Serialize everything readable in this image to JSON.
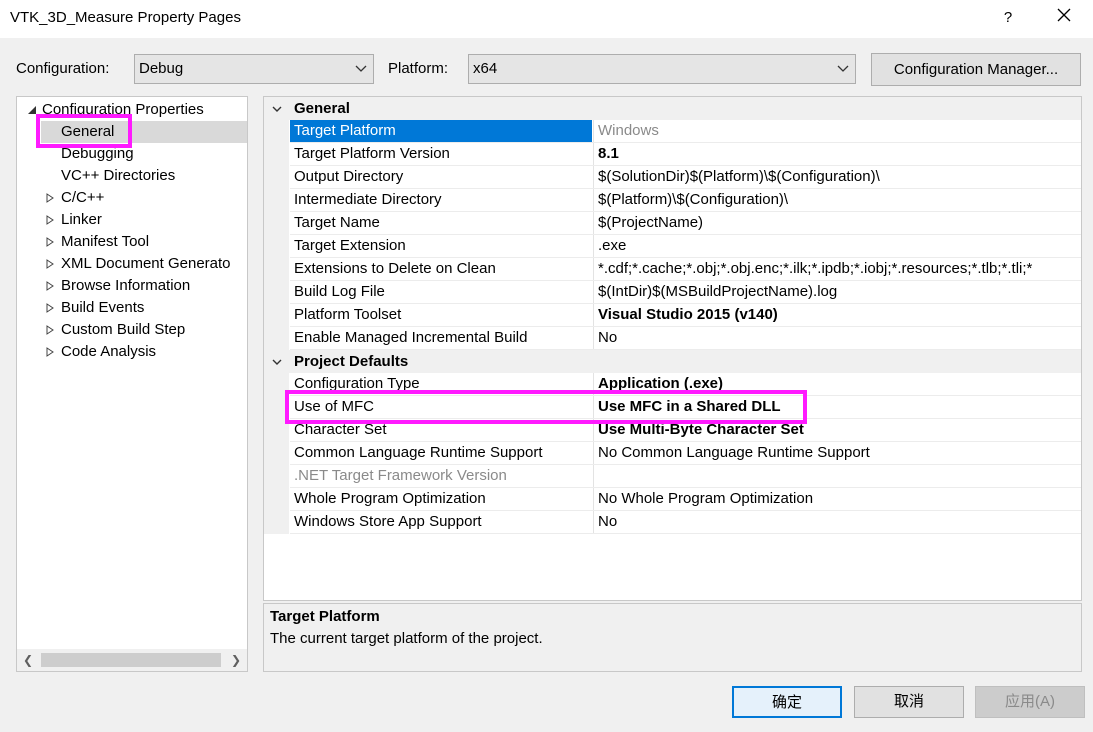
{
  "window": {
    "title": "VTK_3D_Measure Property Pages",
    "help": "?",
    "close_icon": "close-icon"
  },
  "toolbar": {
    "configuration_label": "Configuration:",
    "configuration_value": "Debug",
    "platform_label": "Platform:",
    "platform_value": "x64",
    "config_manager_label": "Configuration Manager..."
  },
  "tree": {
    "root": "Configuration Properties",
    "items": [
      {
        "label": "General",
        "expandable": false,
        "selected": true
      },
      {
        "label": "Debugging",
        "expandable": false
      },
      {
        "label": "VC++ Directories",
        "expandable": false
      },
      {
        "label": "C/C++",
        "expandable": true
      },
      {
        "label": "Linker",
        "expandable": true
      },
      {
        "label": "Manifest Tool",
        "expandable": true
      },
      {
        "label": "XML Document Generato",
        "expandable": true
      },
      {
        "label": "Browse Information",
        "expandable": true
      },
      {
        "label": "Build Events",
        "expandable": true
      },
      {
        "label": "Custom Build Step",
        "expandable": true
      },
      {
        "label": "Code Analysis",
        "expandable": true
      }
    ]
  },
  "grid": {
    "categories": [
      {
        "name": "General",
        "rows": [
          {
            "name": "Target Platform",
            "value": "Windows",
            "selected": true,
            "value_gray": true
          },
          {
            "name": "Target Platform Version",
            "value": "8.1",
            "bold": true
          },
          {
            "name": "Output Directory",
            "value": "$(SolutionDir)$(Platform)\\$(Configuration)\\"
          },
          {
            "name": "Intermediate Directory",
            "value": "$(Platform)\\$(Configuration)\\"
          },
          {
            "name": "Target Name",
            "value": "$(ProjectName)"
          },
          {
            "name": "Target Extension",
            "value": ".exe"
          },
          {
            "name": "Extensions to Delete on Clean",
            "value": "*.cdf;*.cache;*.obj;*.obj.enc;*.ilk;*.ipdb;*.iobj;*.resources;*.tlb;*.tli;*"
          },
          {
            "name": "Build Log File",
            "value": "$(IntDir)$(MSBuildProjectName).log"
          },
          {
            "name": "Platform Toolset",
            "value": "Visual Studio 2015 (v140)",
            "bold": true
          },
          {
            "name": "Enable Managed Incremental Build",
            "value": "No"
          }
        ]
      },
      {
        "name": "Project Defaults",
        "rows": [
          {
            "name": "Configuration Type",
            "value": "Application (.exe)",
            "bold": true
          },
          {
            "name": "Use of MFC",
            "value": "Use MFC in a Shared DLL",
            "bold": true
          },
          {
            "name": "Character Set",
            "value": "Use Multi-Byte Character Set",
            "bold": true
          },
          {
            "name": "Common Language Runtime Support",
            "value": "No Common Language Runtime Support"
          },
          {
            "name": ".NET Target Framework Version",
            "value": "",
            "name_gray": true
          },
          {
            "name": "Whole Program Optimization",
            "value": "No Whole Program Optimization"
          },
          {
            "name": "Windows Store App Support",
            "value": "No"
          }
        ]
      }
    ]
  },
  "description": {
    "title": "Target Platform",
    "text": "The current target platform of the project."
  },
  "buttons": {
    "ok": "确定",
    "cancel": "取消",
    "apply": "应用(A)"
  },
  "colors": {
    "highlight": "#ff1aff",
    "selection": "#0078d7",
    "primary_button_border": "#0078d7"
  }
}
